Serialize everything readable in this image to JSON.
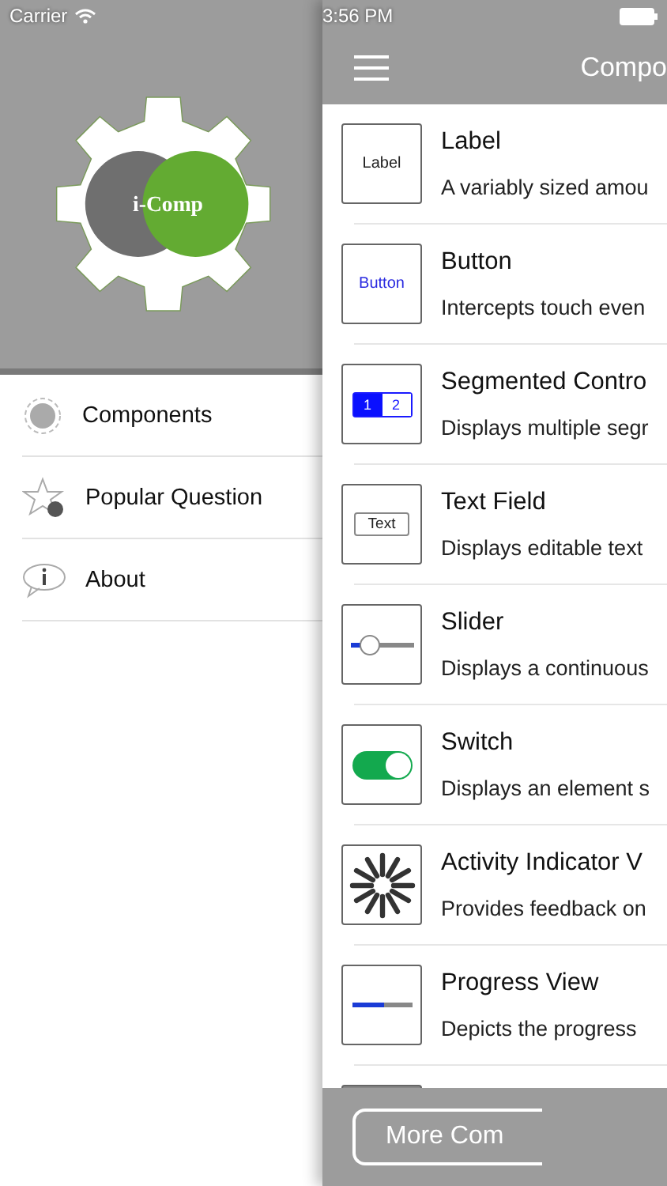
{
  "status_bar": {
    "carrier": "Carrier",
    "time": "3:56 PM"
  },
  "logo": {
    "text": "i-Comp"
  },
  "menu": [
    {
      "kind": "gear",
      "label": "Components"
    },
    {
      "kind": "star",
      "label": "Popular Question"
    },
    {
      "kind": "info",
      "label": "About"
    }
  ],
  "nav_bar": {
    "title": "Compo"
  },
  "components": [
    {
      "kind": "label",
      "preview": "Label",
      "title": "Label",
      "description": "A variably sized amou"
    },
    {
      "kind": "button",
      "preview": "Button",
      "title": "Button",
      "description": "Intercepts touch even"
    },
    {
      "kind": "segmented",
      "segments": [
        {
          "label": "1",
          "selected": true
        },
        {
          "label": "2",
          "selected": false
        }
      ],
      "title": "Segmented Contro",
      "description": "Displays multiple segr"
    },
    {
      "kind": "textfield",
      "preview": "Text",
      "title": "Text Field",
      "description": "Displays editable text"
    },
    {
      "kind": "slider",
      "level": 0.3,
      "title": "Slider",
      "description": "Displays a continuous"
    },
    {
      "kind": "switch",
      "on": true,
      "title": "Switch",
      "description": "Displays an element s"
    },
    {
      "kind": "activity",
      "title": "Activity Indicator V",
      "description": "Provides feedback on"
    },
    {
      "kind": "progress",
      "level": 0.55,
      "title": "Progress View",
      "description": "Depicts the progress"
    },
    {
      "kind": "partial"
    }
  ],
  "footer": {
    "button": "More Com"
  }
}
